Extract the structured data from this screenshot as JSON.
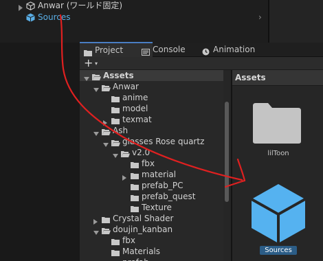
{
  "hierarchy": {
    "items": [
      {
        "label": "Anwar (ワールド固定)",
        "icon": "gameobject-icon"
      },
      {
        "label": "Sources",
        "icon": "cube-icon"
      }
    ]
  },
  "panel": {
    "tabs": [
      {
        "label": "Project",
        "icon": "folder-tab-icon",
        "active": true
      },
      {
        "label": "Console",
        "icon": "console-icon"
      },
      {
        "label": "Animation",
        "icon": "clock-icon"
      }
    ],
    "toolbar": {
      "add_label": "+",
      "caret": "▾"
    },
    "tree": [
      {
        "label": "Assets"
      },
      {
        "label": "Anwar"
      },
      {
        "label": "anime"
      },
      {
        "label": "model"
      },
      {
        "label": "texmat"
      },
      {
        "label": "Ash"
      },
      {
        "label": "glasses Rose quartz"
      },
      {
        "label": "v2.0"
      },
      {
        "label": "fbx"
      },
      {
        "label": "material"
      },
      {
        "label": "prefab_PC"
      },
      {
        "label": "prefab_quest"
      },
      {
        "label": "Texture"
      },
      {
        "label": "Crystal Shader"
      },
      {
        "label": "doujin_kanban"
      },
      {
        "label": "fbx"
      },
      {
        "label": "Materials"
      },
      {
        "label": "prefab"
      }
    ],
    "grid": {
      "header": "Assets",
      "items": [
        {
          "label": "lilToon",
          "icon": "folder-icon"
        },
        {
          "label": "Sources",
          "icon": "cube-icon",
          "selected": true
        }
      ]
    }
  },
  "colors": {
    "accent_blue": "#5aaee6",
    "cube_blue": "#55b2f0",
    "selection": "#2c5d87",
    "annotation_red": "#e02020"
  }
}
